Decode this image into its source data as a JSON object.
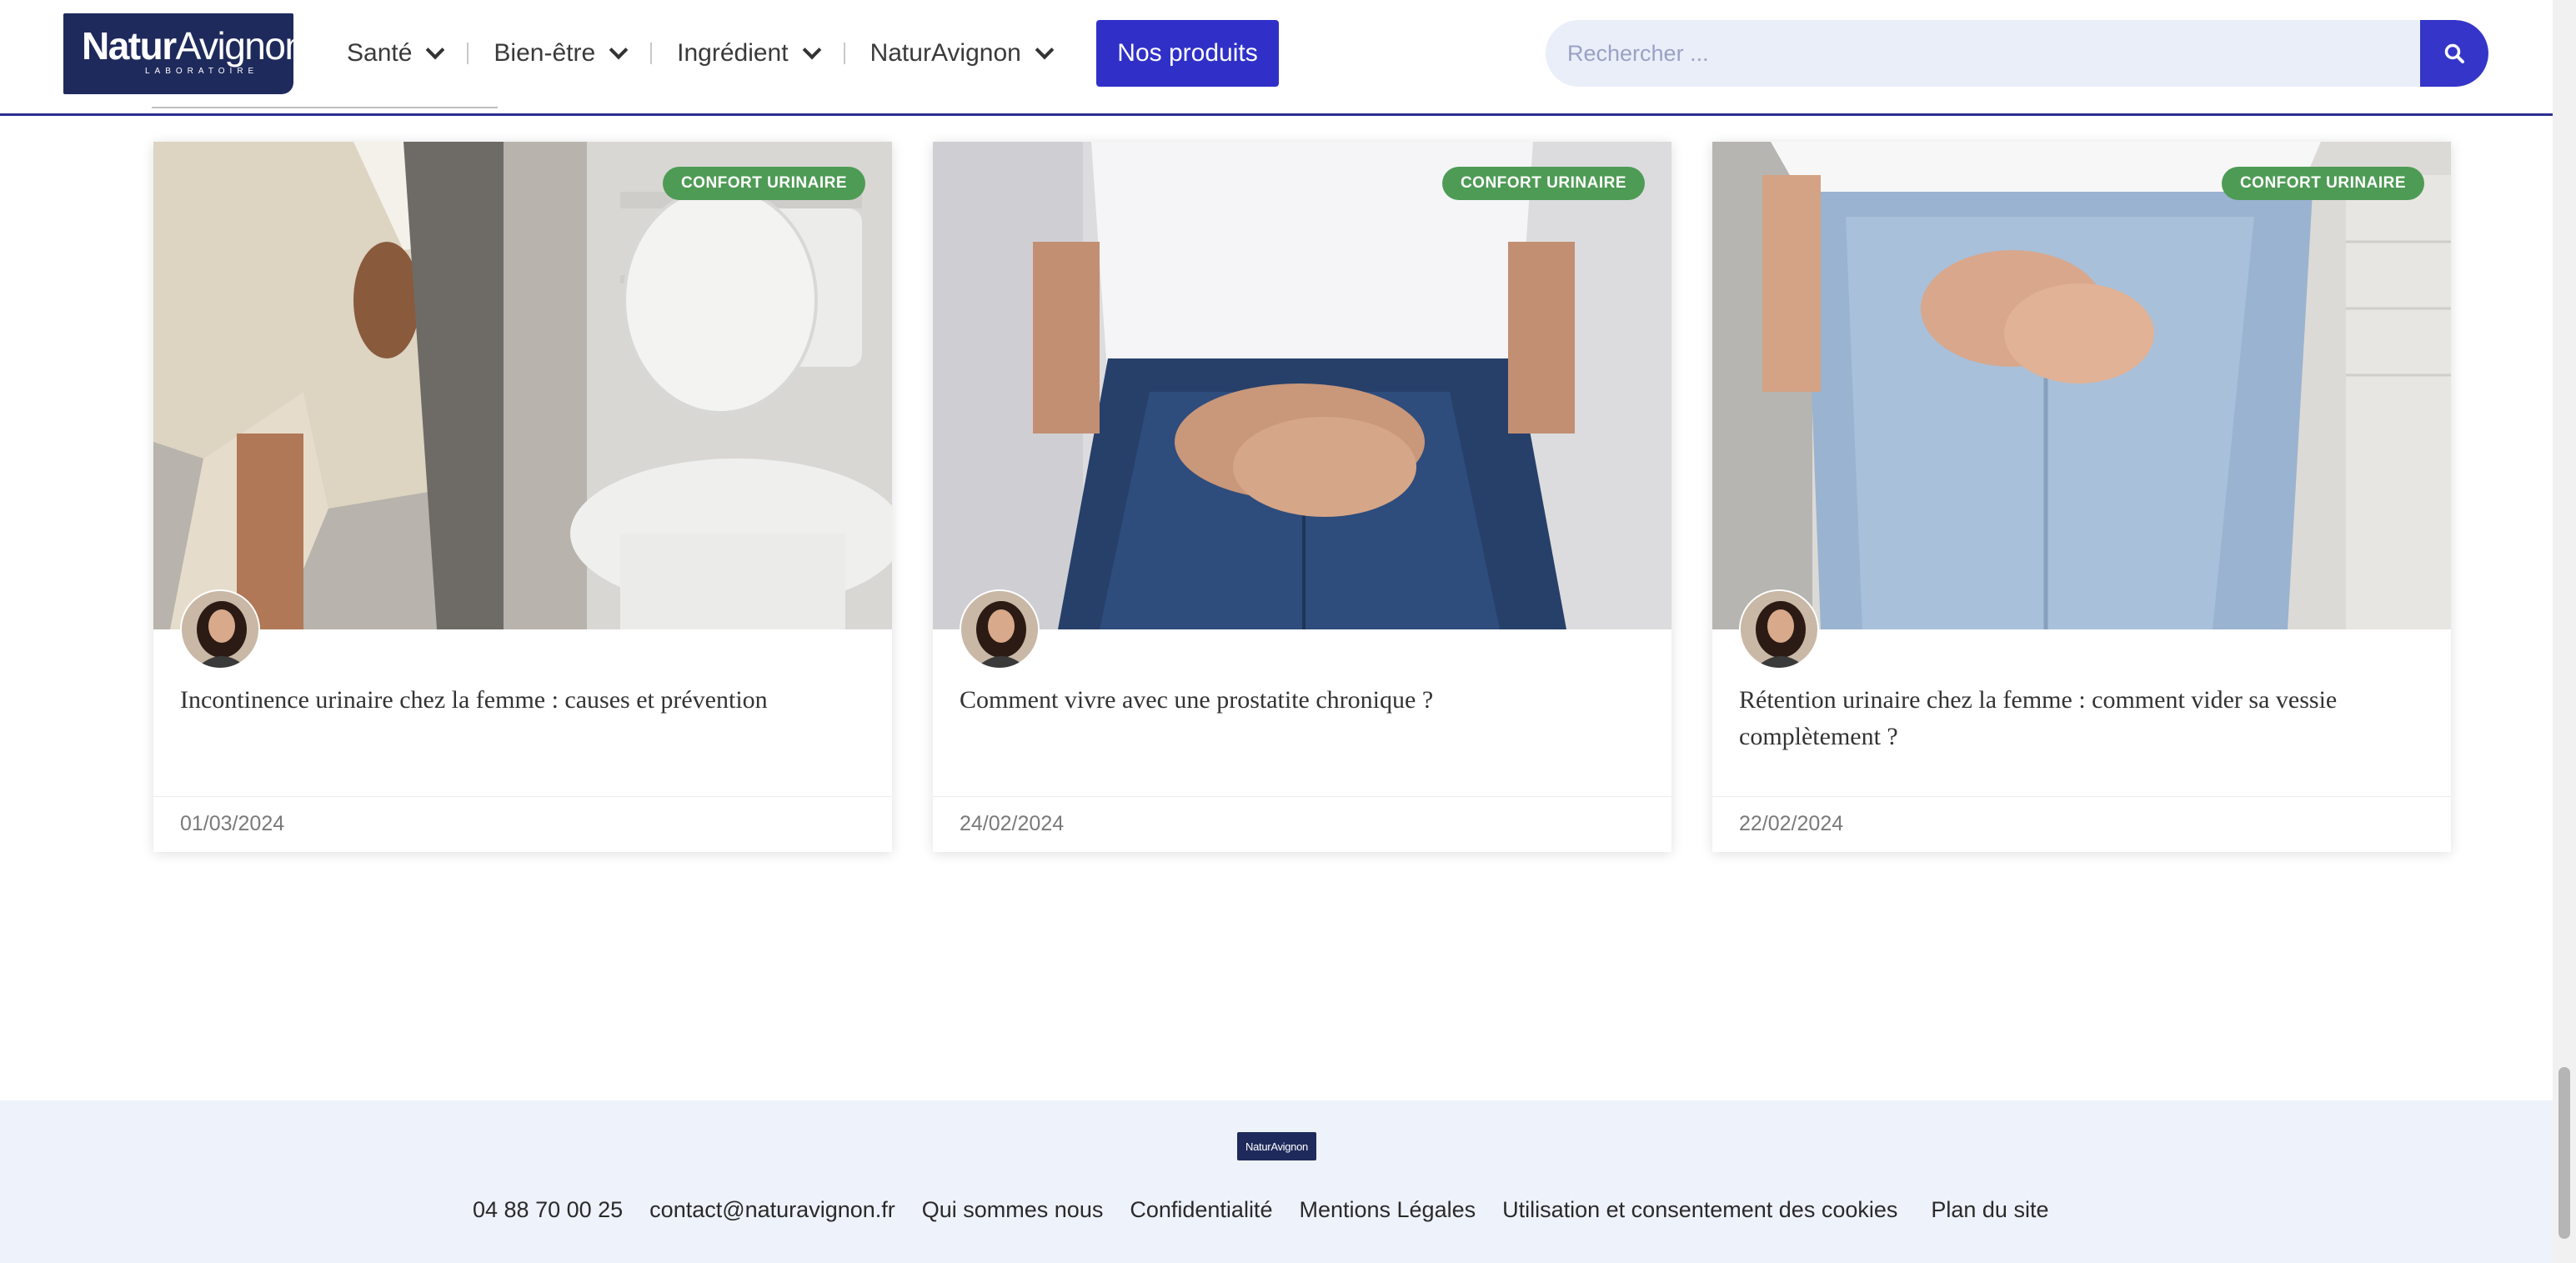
{
  "header": {
    "logo_text_bold": "Natur",
    "logo_text_thin": "Avignon",
    "logo_subtext": "LABORATOIRE",
    "nav": [
      {
        "label": "Santé",
        "icon": "chevron-down-icon"
      },
      {
        "label": "Bien-être",
        "icon": "chevron-down-icon"
      },
      {
        "label": "Ingrédient",
        "icon": "chevron-down-icon"
      },
      {
        "label": "NaturAvignon",
        "icon": "chevron-down-icon"
      }
    ],
    "cta_label": "Nos produits",
    "search": {
      "placeholder": "Rechercher ...",
      "value": "",
      "icon": "search-icon"
    }
  },
  "articles": [
    {
      "category": "CONFORT URINAIRE",
      "title": "Incontinence urinaire chez la femme : causes et prévention",
      "date": "01/03/2024"
    },
    {
      "category": "CONFORT URINAIRE",
      "title": "Comment vivre avec une prostatite chronique ?",
      "date": "24/02/2024"
    },
    {
      "category": "CONFORT URINAIRE",
      "title": "Rétention urinaire chez la femme : comment vider sa vessie complètement ?",
      "date": "22/02/2024"
    }
  ],
  "footer": {
    "logo_text": "NaturAvignon",
    "links": [
      "04 88 70 00 25",
      "contact@naturavignon.fr",
      "Qui sommes nous",
      "Confidentialité",
      "Mentions Légales",
      "Utilisation et consentement des cookies",
      "Plan du site"
    ]
  },
  "colors": {
    "brand_navy": "#1f2a5c",
    "accent_blue": "#3030c8",
    "badge_green": "#4e9b55",
    "footer_bg": "#eef2fa",
    "search_bg": "#eaeef9"
  }
}
